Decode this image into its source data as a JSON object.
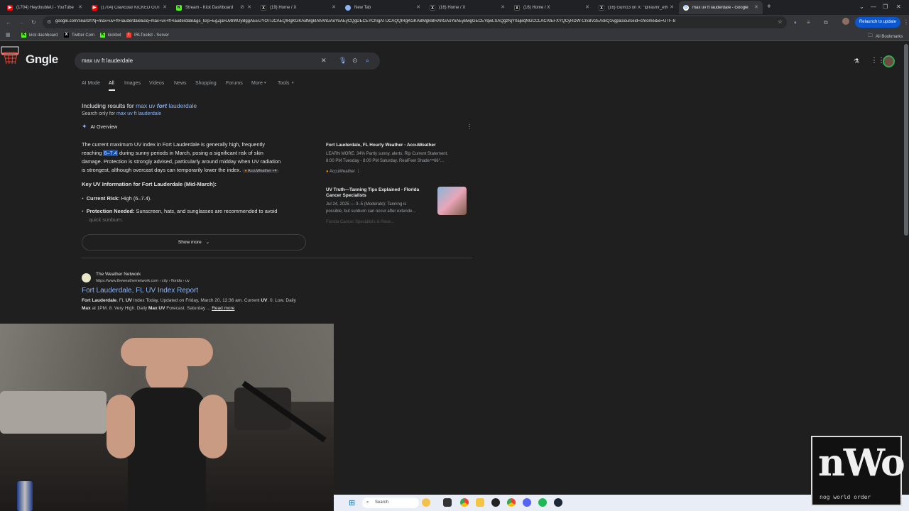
{
  "tabs": [
    {
      "title": "(1704) HeydoubleU - YouTube",
      "icon": "youtube-icon",
      "color": "#ff0000"
    },
    {
      "title": "(1704) Clavicular KICKED OUT",
      "icon": "youtube-icon",
      "color": "#ff0000"
    },
    {
      "title": "Stream - Kick Dashboard",
      "icon": "kick-icon",
      "color": "#53fc18"
    },
    {
      "title": "(19) Home / X",
      "icon": "x-icon",
      "color": "#000000"
    },
    {
      "title": "New Tab",
      "icon": "chrome-icon",
      "color": "#8ab4f8"
    },
    {
      "title": "(16) Home / X",
      "icon": "x-icon",
      "color": "#000000"
    },
    {
      "title": "(16) Home / X",
      "icon": "x-icon",
      "color": "#000000"
    },
    {
      "title": "(16) Gum13 on X: \"@rasmr_eth",
      "icon": "x-icon",
      "color": "#000000"
    },
    {
      "title": "max uv ft lauderdale - Google",
      "icon": "google-icon",
      "color": "#4285f4"
    }
  ],
  "toolbar": {
    "url": "google.com/search?q=max+uv+ft+lauderdale&oq=max+uv+ft+lauderdale&gs_lcrp=EgZjaHJvbWUyBggAEEUYOTIJCAEQIRgKGKABMgkIAhAhGAoYoAEyCQgDECEYChigATIJCAQQIRgKGKABMgkIBRAhGAoYoAEyBwgGECEYqwLSAQgzNjY0ajBqNGCCLACAfEFXYQCyRDW-CrxBV2EAskQ1vgp&sourceid=chrome&ie=UTF-8",
    "relaunch_label": "Relaunch to update"
  },
  "bookmarks": {
    "items": [
      {
        "label": "kick dashboard",
        "color": "#53fc18",
        "glyph": "K"
      },
      {
        "label": "Twitter Com",
        "color": "#000000",
        "glyph": "X"
      },
      {
        "label": "kickbot",
        "color": "#53fc18",
        "glyph": "K"
      },
      {
        "label": "IRLToolkit - Server",
        "color": "#ea4335",
        "glyph": "I"
      }
    ],
    "all_label": "All Bookmarks"
  },
  "search": {
    "logo": "Gngle",
    "query": "max uv ft lauderdale"
  },
  "filters": [
    "AI Mode",
    "All",
    "Images",
    "Videos",
    "News",
    "Shopping",
    "Forums",
    "More",
    "Tools"
  ],
  "results": {
    "including_prefix": "Including results for",
    "including_a": "max uv",
    "including_b": "fort",
    "including_c": "lauderdale",
    "search_only_prefix": "Search only for",
    "search_only_link": "max uv ft lauderdale",
    "ai_overview_label": "AI Overview",
    "ai_p1_a": "The current maximum UV index in Fort Lauderdale is generally high, frequently",
    "ai_p1_b": "reaching",
    "ai_p1_hl": "6–7.4",
    "ai_p1_c": "during sunny periods in March, posing a significant risk of skin",
    "ai_p1_d": "damage. Protection is strongly advised, particularly around midday when UV radiation",
    "ai_p1_e": "is strongest, although overcast days can temporarily lower the index.",
    "ai_p1_source": "AccuWeather +4",
    "key_heading": "Key UV Information for Fort Lauderdale (Mid-March):",
    "bullet1_label": "Current Risk:",
    "bullet1_text": "High (6–7.4).",
    "bullet2_label": "Protection Needed:",
    "bullet2_text": "Sunscreen, hats, and sunglasses are recommended to avoid",
    "bullet2_cont": "quick sunburn.",
    "show_more": "Show more",
    "card1_title": "Fort Lauderdale, FL Hourly Weather - AccuWeather",
    "card1_line1": "LEARN MORE. 34% Partly sunny. alerts. Rlp Current Statement.",
    "card1_line2": "8:00 PM Tuesday - 8:00 PM Saturday. RealFeel Shade™66°...",
    "card1_source": "AccuWeather",
    "card2_title_1": "UV Truth—Tanning Tips Explained - Florida",
    "card2_title_2": "Cancer Specialists",
    "card2_line1": "Jul 24, 2025 — 3–5 (Moderate): Tanning is",
    "card2_line2": "possible, but sunburn can occur after extende...",
    "card2_source": "Florida Cancer Specialists & Rese...",
    "r1_site": "The Weather Network",
    "r1_url": "https://www.theweathernetwork.com › city › florida › uv",
    "r1_title": "Fort Lauderdale, FL UV Index Report",
    "r1_s1_a": "Fort Lauderdale",
    "r1_s1_b": ", FL",
    "r1_s1_c": "UV",
    "r1_s1_d": "Index Today. Updated on Friday, March 20, 12:36 am. Current",
    "r1_s1_e": "UV",
    "r1_s1_f": ". 0. Low. Daily",
    "r1_s2_a": "Max",
    "r1_s2_b": "at 1PM. 8. Very High. Daily",
    "r1_s2_c": "Max UV",
    "r1_s2_d": "Forecast. Saturday ...",
    "r1_read_more": "Read more"
  },
  "taskbar": {
    "search_placeholder": "Search"
  },
  "overlay": {
    "logo_text": "nWo",
    "logo_sub": "nog world order"
  }
}
